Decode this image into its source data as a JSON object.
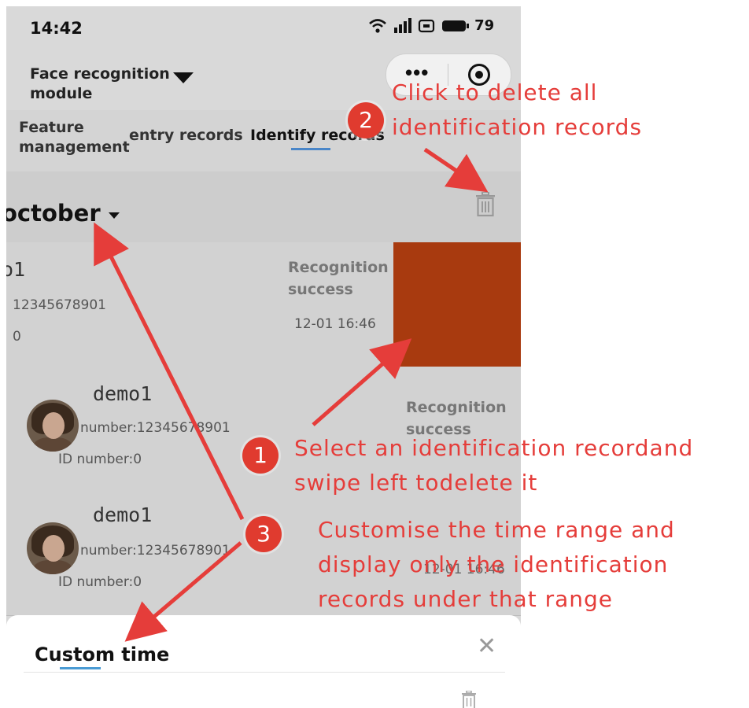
{
  "status_bar": {
    "time": "14:42",
    "battery": "79",
    "icons": [
      "wifi-icon",
      "signal-icon",
      "hd-icon",
      "battery-icon"
    ]
  },
  "header": {
    "title": "Face recognition module"
  },
  "tabs": [
    {
      "label": "Feature management"
    },
    {
      "label": "entry records"
    },
    {
      "label": "Identify records",
      "active": true
    }
  ],
  "filter": {
    "month": "october"
  },
  "records": [
    {
      "name": "o1",
      "phone": "12345678901",
      "id": "0",
      "status": "Recognition success",
      "time": "12-01 16:46"
    },
    {
      "name": "demo1",
      "phone_label": "number:12345678901",
      "id_label": "ID number:0",
      "status": "Recognition success"
    },
    {
      "name": "demo1",
      "phone_label": "number:12345678901",
      "id_label": "ID number:0",
      "time": "12-01 16:46"
    }
  ],
  "sheet": {
    "title": "Custom time"
  },
  "annotations": [
    {
      "badge": "1",
      "text": "Select an identification recordand swipe left todelete it"
    },
    {
      "badge": "2",
      "text": "Click to delete all identification records"
    },
    {
      "badge": "3",
      "text": "Customise the time range and display only the identification records under that range"
    }
  ],
  "colors": {
    "annotation_red": "#e53d3a",
    "delete_block": "#a83a0f",
    "tab_indicator": "#4a86c8"
  }
}
